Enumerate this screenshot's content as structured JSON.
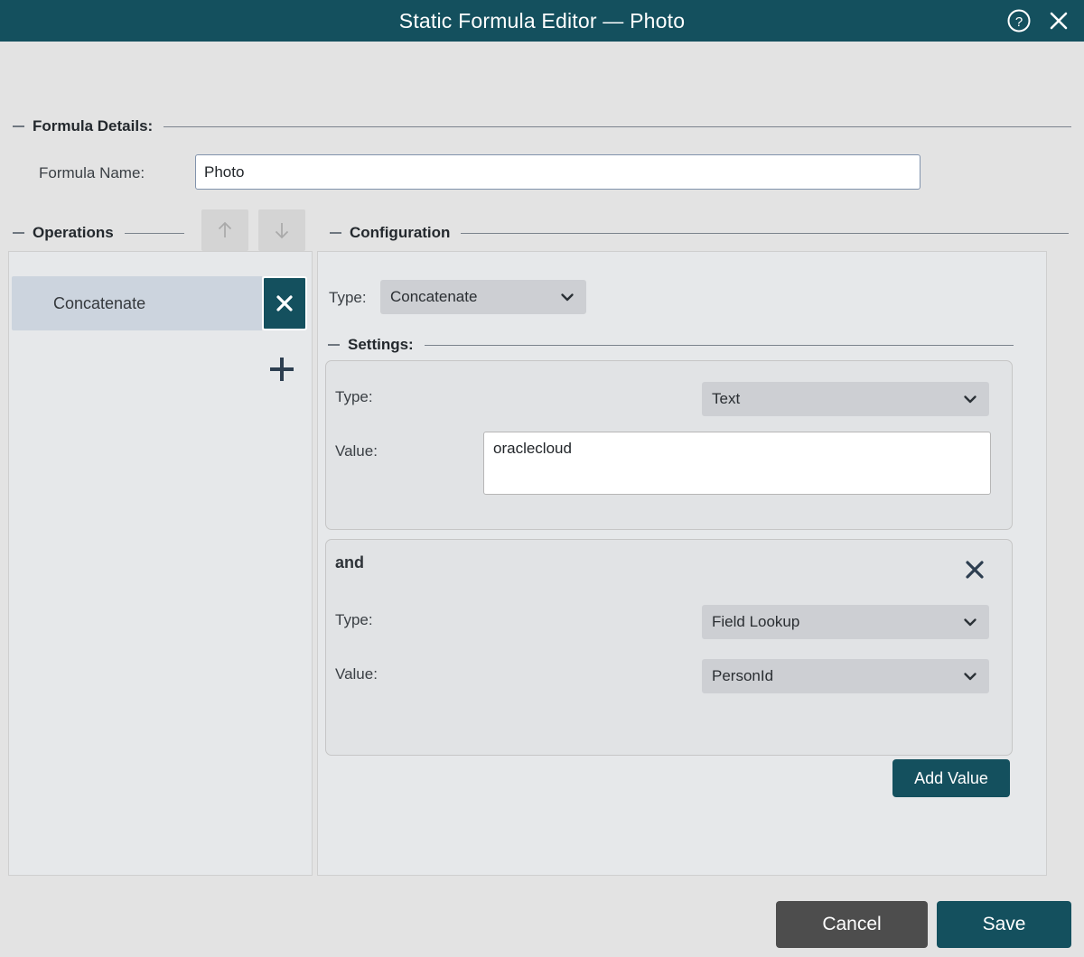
{
  "window": {
    "title": "Static Formula Editor — Photo",
    "help_icon": "question-mark-circle-icon",
    "close_icon": "close-icon"
  },
  "formula_details": {
    "legend": "Formula Details:",
    "name_label": "Formula Name:",
    "name_value": "Photo",
    "name_placeholder": ""
  },
  "operations": {
    "legend": "Operations",
    "move_up_icon": "arrow-up-icon",
    "move_down_icon": "arrow-down-icon",
    "add_icon": "plus-icon",
    "items": [
      {
        "label": "Concatenate",
        "selected": true,
        "remove_icon": "close-icon"
      }
    ]
  },
  "configuration": {
    "legend": "Configuration",
    "type_label": "Type:",
    "type_value": "Concatenate",
    "type_options": [
      "Concatenate"
    ],
    "settings": {
      "legend": "Settings:",
      "values": [
        {
          "conjunction": "",
          "type_label": "Type:",
          "type_value": "Text",
          "value_label": "Value:",
          "value_control": "textarea",
          "value_text": "oraclecloud",
          "removable": false
        },
        {
          "conjunction": "and",
          "type_label": "Type:",
          "type_value": "Field Lookup",
          "value_label": "Value:",
          "value_control": "select",
          "value_text": "PersonId",
          "removable": true,
          "remove_icon": "close-icon"
        }
      ],
      "add_value_label": "Add Value"
    }
  },
  "footer": {
    "cancel_label": "Cancel",
    "save_label": "Save"
  },
  "colors": {
    "accent_teal": "#14505e",
    "page_background": "#e3e3e3",
    "panel_background": "#e6e8ea",
    "selected_item": "#ccd4de",
    "select_background": "#cdcfd3",
    "cancel_gray": "#4d4d4d",
    "icon_navy": "#2d3e50"
  }
}
